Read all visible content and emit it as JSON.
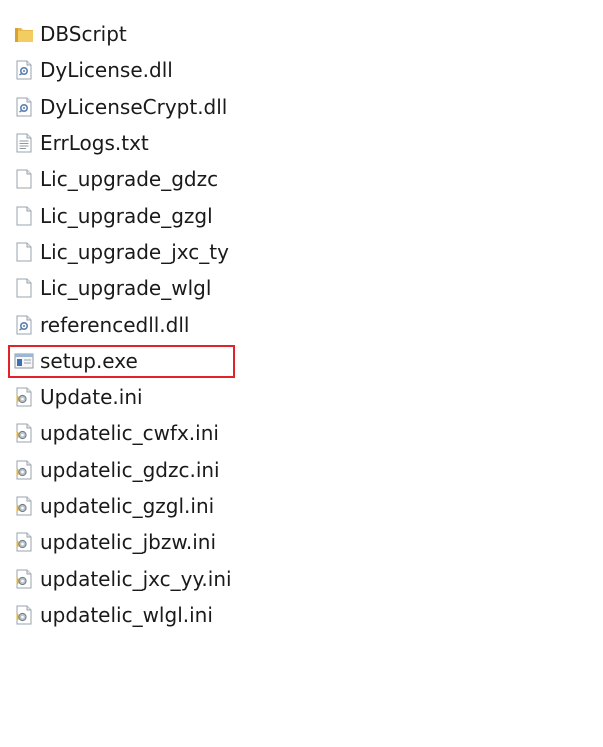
{
  "files": [
    {
      "name": "DBScript",
      "icon": "folder-icon"
    },
    {
      "name": "DyLicense.dll",
      "icon": "dll-icon"
    },
    {
      "name": "DyLicenseCrypt.dll",
      "icon": "dll-icon"
    },
    {
      "name": "ErrLogs.txt",
      "icon": "text-file-icon"
    },
    {
      "name": "Lic_upgrade_gdzc",
      "icon": "blank-file-icon"
    },
    {
      "name": "Lic_upgrade_gzgl",
      "icon": "blank-file-icon"
    },
    {
      "name": "Lic_upgrade_jxc_ty",
      "icon": "blank-file-icon"
    },
    {
      "name": "Lic_upgrade_wlgl",
      "icon": "blank-file-icon"
    },
    {
      "name": "referencedll.dll",
      "icon": "dll-icon"
    },
    {
      "name": "setup.exe",
      "icon": "exe-icon",
      "highlighted": true
    },
    {
      "name": "Update.ini",
      "icon": "ini-icon"
    },
    {
      "name": "updatelic_cwfx.ini",
      "icon": "ini-icon"
    },
    {
      "name": "updatelic_gdzc.ini",
      "icon": "ini-icon"
    },
    {
      "name": "updatelic_gzgl.ini",
      "icon": "ini-icon"
    },
    {
      "name": "updatelic_jbzw.ini",
      "icon": "ini-icon"
    },
    {
      "name": "updatelic_jxc_yy.ini",
      "icon": "ini-icon"
    },
    {
      "name": "updatelic_wlgl.ini",
      "icon": "ini-icon"
    }
  ],
  "colors": {
    "highlight_border": "#e0232b",
    "folder": "#e8b84a",
    "text": "#1a1a1a"
  }
}
